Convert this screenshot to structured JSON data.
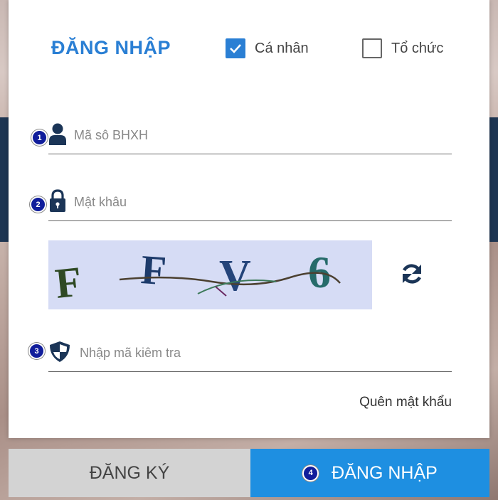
{
  "header": {
    "title": "ĐĂNG NHẬP",
    "options": [
      {
        "label": "Cá nhân",
        "checked": true
      },
      {
        "label": "Tổ chức",
        "checked": false
      }
    ]
  },
  "fields": {
    "bhxh": {
      "placeholder": "Mã sô BHXH",
      "value": "",
      "icon": "user-icon"
    },
    "password": {
      "placeholder": "Mật khâu",
      "value": "",
      "icon": "lock-icon"
    },
    "captcha_input": {
      "placeholder": "Nhập mã kiêm tra",
      "value": "",
      "icon": "shield-icon"
    }
  },
  "captcha": {
    "text": "FFV6",
    "characters": [
      "F",
      "F",
      "V",
      "6"
    ],
    "refresh_icon": "refresh-icon"
  },
  "badges": [
    "1",
    "2",
    "3",
    "4"
  ],
  "forgot_password": "Quên mật khẩu",
  "buttons": {
    "register": "ĐĂNG KÝ",
    "login": "ĐĂNG NHẬP"
  },
  "colors": {
    "accent": "#2a7fd4",
    "login_button": "#1e8fe1",
    "register_button": "#d3d3d3",
    "badge": "#101d9b",
    "icon": "#1b3557"
  }
}
